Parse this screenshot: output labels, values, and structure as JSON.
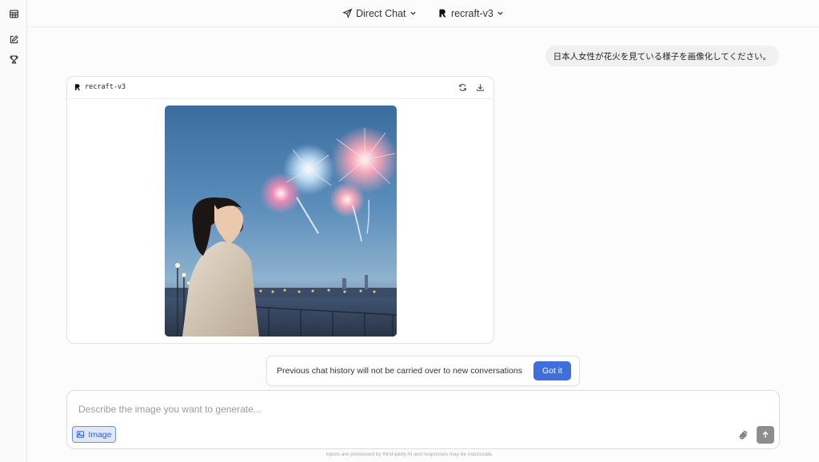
{
  "sidebar": {
    "icons": [
      "table-icon",
      "edit-icon",
      "trophy-icon"
    ]
  },
  "header": {
    "mode_label": "Direct Chat",
    "model_label": "recraft-v3"
  },
  "conversation": {
    "user_message": "日本人女性が花火を見ている様子を画像化してください。",
    "response": {
      "model_name": "recraft-v3",
      "actions": [
        "refresh-icon",
        "download-icon"
      ],
      "image_subject": "woman watching fireworks at dusk by waterfront"
    }
  },
  "notice": {
    "text": "Previous chat history will not be carried over to new conversations",
    "button_label": "Got it"
  },
  "composer": {
    "placeholder": "Describe the image you want to generate...",
    "value": "",
    "image_chip_label": "Image"
  },
  "footer": {
    "disclaimer": "Inputs are processed by third-party AI and responses may be inaccurate."
  },
  "colors": {
    "accent": "#3f6fdc",
    "chip_bg": "#dfe8fb",
    "send_disabled": "#8d8d8d"
  }
}
